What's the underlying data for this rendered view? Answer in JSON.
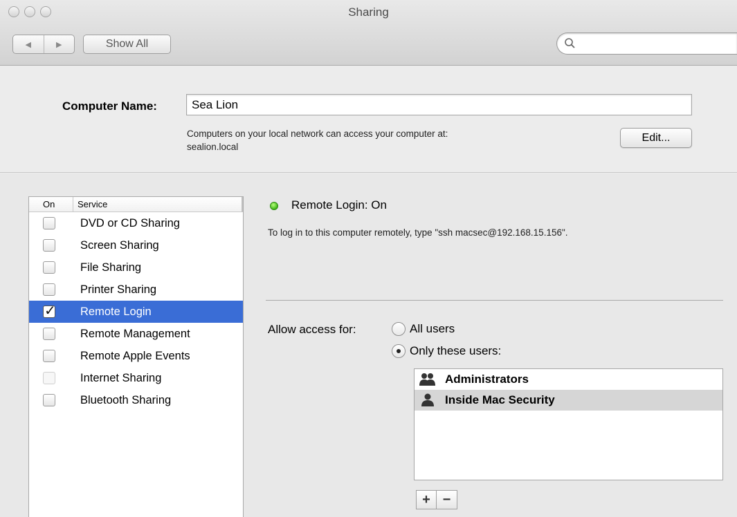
{
  "window": {
    "title": "Sharing"
  },
  "toolbar": {
    "back_glyph": "◀",
    "forward_glyph": "▶",
    "show_all_label": "Show All",
    "search_placeholder": ""
  },
  "computer_name": {
    "label": "Computer Name:",
    "value": "Sea Lion",
    "help_line1": "Computers on your local network can access your computer at:",
    "help_line2": "sealion.local",
    "edit_label": "Edit..."
  },
  "services": {
    "header_on": "On",
    "header_service": "Service",
    "items": [
      {
        "label": "DVD or CD Sharing",
        "checked": false,
        "selected": false,
        "faint": false
      },
      {
        "label": "Screen Sharing",
        "checked": false,
        "selected": false,
        "faint": false
      },
      {
        "label": "File Sharing",
        "checked": false,
        "selected": false,
        "faint": false
      },
      {
        "label": "Printer Sharing",
        "checked": false,
        "selected": false,
        "faint": false
      },
      {
        "label": "Remote Login",
        "checked": true,
        "selected": true,
        "faint": false
      },
      {
        "label": "Remote Management",
        "checked": false,
        "selected": false,
        "faint": false
      },
      {
        "label": "Remote Apple Events",
        "checked": false,
        "selected": false,
        "faint": false
      },
      {
        "label": "Internet Sharing",
        "checked": false,
        "selected": false,
        "faint": true
      },
      {
        "label": "Bluetooth Sharing",
        "checked": false,
        "selected": false,
        "faint": false
      }
    ]
  },
  "detail": {
    "status_color": "#3fb518",
    "status_text": "Remote Login: On",
    "hint": "To log in to this computer remotely, type \"ssh macsec@192.168.15.156\".",
    "allow_label": "Allow access for:",
    "option_all": "All users",
    "option_only": "Only these users:",
    "selected_option": "only",
    "users": [
      {
        "name": "Administrators",
        "icon": "group-icon",
        "selected": false
      },
      {
        "name": "Inside Mac Security",
        "icon": "user-icon",
        "selected": true
      }
    ],
    "add_label": "+",
    "remove_label": "−"
  },
  "colors": {
    "selection": "#3a6dd6",
    "user_selection": "#d6d6d6"
  }
}
